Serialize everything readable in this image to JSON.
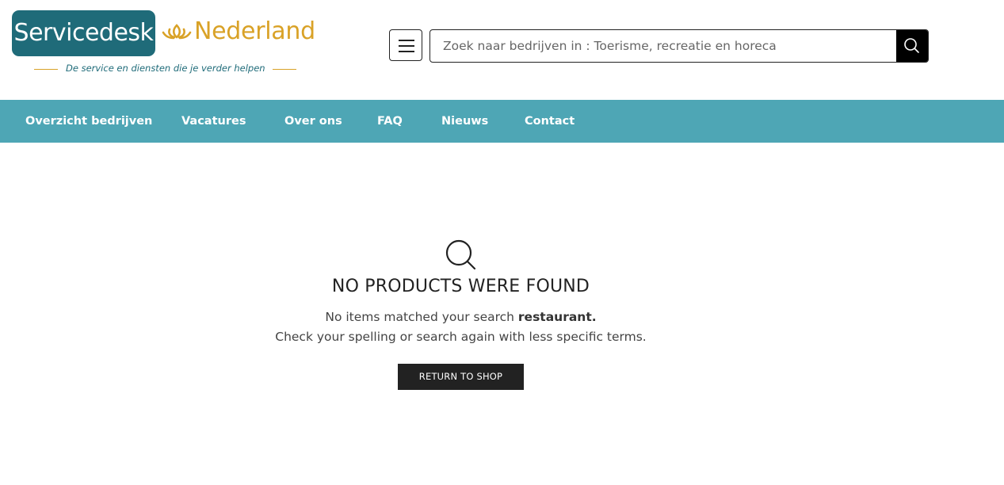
{
  "brand": {
    "logo_text": "Servicedesk",
    "logo_suffix": "Nederland",
    "tagline": "De service en diensten die je verder helpen",
    "colors": {
      "teal": "#1f6b79",
      "gold": "#d9a227"
    }
  },
  "header": {
    "menu_icon": "hamburger-icon",
    "search": {
      "placeholder": "Zoek naar bedrijven in : Toerisme, recreatie en horeca",
      "value": "",
      "icon": "search-icon"
    }
  },
  "nav": {
    "background": "#4ea6b5",
    "items": [
      {
        "label": "Overzicht bedrijven"
      },
      {
        "label": "Vacatures"
      },
      {
        "label": "Over ons"
      },
      {
        "label": "FAQ"
      },
      {
        "label": "Nieuws"
      },
      {
        "label": "Contact"
      }
    ]
  },
  "empty_state": {
    "icon": "search-icon",
    "title": "NO PRODUCTS WERE FOUND",
    "line1_prefix": "No items matched your search ",
    "query": "restaurant.",
    "line2": "Check your spelling or search again with less specific terms.",
    "button_label": "RETURN TO SHOP"
  }
}
